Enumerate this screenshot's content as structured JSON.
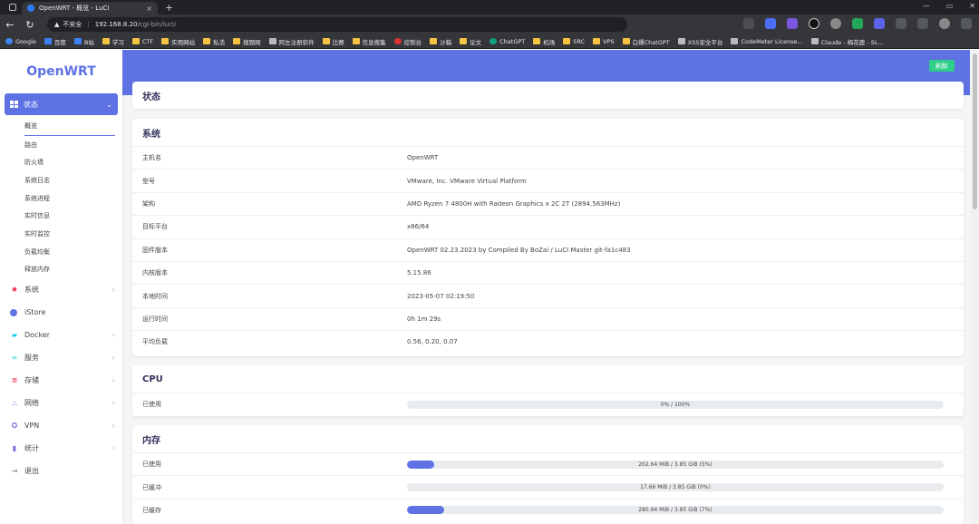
{
  "browser": {
    "tab_title": "OpenWRT - 概览 - LuCI",
    "tab_close": "×",
    "new_tab": "+",
    "window_controls": [
      "—",
      "▭",
      "✕"
    ],
    "nav": {
      "back": "←",
      "reload": "↻"
    },
    "address": {
      "warning_icon": "▲",
      "insecure_label": "不安全",
      "separator": "|",
      "host": "192.168.8.20",
      "path": "/cgi-bin/luci/"
    },
    "bookmarks": [
      {
        "label": "Google",
        "icon": "google-icon"
      },
      {
        "label": "百度",
        "icon": "baidu-icon"
      },
      {
        "label": "B站",
        "icon": "bilibili-icon"
      },
      {
        "label": "学习",
        "icon": "folder-icon"
      },
      {
        "label": "CTF",
        "icon": "folder-icon"
      },
      {
        "label": "实用网站",
        "icon": "folder-icon"
      },
      {
        "label": "私活",
        "icon": "folder-icon"
      },
      {
        "label": "搜题网",
        "icon": "folder-icon"
      },
      {
        "label": "阿左注册软件",
        "icon": "page-icon"
      },
      {
        "label": "比赛",
        "icon": "folder-icon"
      },
      {
        "label": "信息搜集",
        "icon": "folder-icon"
      },
      {
        "label": "控制台",
        "icon": "huawei-icon"
      },
      {
        "label": "沙箱",
        "icon": "folder-icon"
      },
      {
        "label": "论文",
        "icon": "folder-icon"
      },
      {
        "label": "ChatGPT",
        "icon": "chatgpt-icon"
      },
      {
        "label": "机场",
        "icon": "folder-icon"
      },
      {
        "label": "SRC",
        "icon": "folder-icon"
      },
      {
        "label": "VPS",
        "icon": "folder-icon"
      },
      {
        "label": "白嫖ChatGPT",
        "icon": "folder-icon"
      },
      {
        "label": "XSS安全平台",
        "icon": "page-icon"
      },
      {
        "label": "CodeMeter License...",
        "icon": "page-icon"
      },
      {
        "label": "Claude - 梅花鹿 - SL...",
        "icon": "page-icon"
      }
    ]
  },
  "sidebar": {
    "brand": "OpenWRT",
    "active_menu": {
      "label": "状态",
      "icon": "dashboard-icon",
      "chevron": "⌄"
    },
    "submenu": [
      "概览",
      "路由",
      "防火墙",
      "系统日志",
      "系统进程",
      "实时信息",
      "实时监控",
      "负载均衡",
      "释放内存"
    ],
    "menu": [
      {
        "label": "系统",
        "icon": "gear-icon",
        "chevron": "›"
      },
      {
        "label": "iStore",
        "icon": "store-icon",
        "chevron": ""
      },
      {
        "label": "Docker",
        "icon": "docker-icon",
        "chevron": "›"
      },
      {
        "label": "服务",
        "icon": "link-icon",
        "chevron": "›"
      },
      {
        "label": "存储",
        "icon": "storage-icon",
        "chevron": "›"
      },
      {
        "label": "网络",
        "icon": "network-icon",
        "chevron": "›"
      },
      {
        "label": "VPN",
        "icon": "vpn-icon",
        "chevron": "›"
      },
      {
        "label": "统计",
        "icon": "stats-icon",
        "chevron": "›"
      },
      {
        "label": "退出",
        "icon": "logout-icon",
        "chevron": ""
      }
    ]
  },
  "header": {
    "refresh_label": "刷新",
    "page_title": "状态"
  },
  "system": {
    "title": "系统",
    "rows": [
      {
        "k": "主机名",
        "v": "OpenWRT"
      },
      {
        "k": "型号",
        "v": "VMware, Inc. VMware Virtual Platform"
      },
      {
        "k": "架构",
        "v": "AMD Ryzen 7 4800H with Radeon Graphics x 2C 2T (2894.563MHz)"
      },
      {
        "k": "目标平台",
        "v": "x86/64"
      },
      {
        "k": "固件版本",
        "v": "OpenWRT 02.23.2023 by Compiled By BoZai / LuCI Master git-fa1c483"
      },
      {
        "k": "内核版本",
        "v": "5.15.86"
      },
      {
        "k": "本地时间",
        "v": "2023-05-07 02:19:50"
      },
      {
        "k": "运行时间",
        "v": "0h 1m 29s"
      },
      {
        "k": "平均负载",
        "v": "0.56, 0.20, 0.07"
      }
    ]
  },
  "cpu": {
    "title": "CPU",
    "rows": [
      {
        "k": "已使用",
        "text": "0% / 100%",
        "fraction": 0.0
      }
    ]
  },
  "memory": {
    "title": "内存",
    "rows": [
      {
        "k": "已使用",
        "text": "202.64 MiB / 3.85 GiB (5%)",
        "fraction": 0.05
      },
      {
        "k": "已缓冲",
        "text": "17.66 MiB / 3.85 GiB (0%)",
        "fraction": 0.0
      },
      {
        "k": "已缓存",
        "text": "280.94 MiB / 3.85 GiB (7%)",
        "fraction": 0.07
      }
    ]
  },
  "colors": {
    "accent": "#5e72e4",
    "refresh": "#2dce89",
    "page_bg": "#f4f5f7"
  }
}
